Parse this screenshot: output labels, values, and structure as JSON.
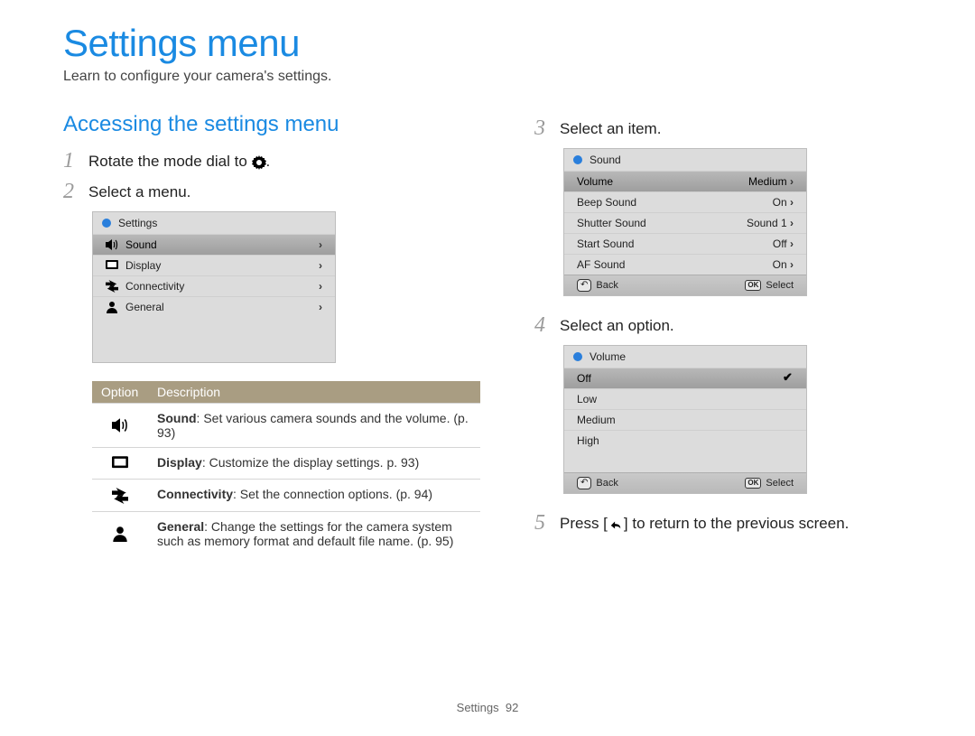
{
  "title": "Settings menu",
  "subtitle": "Learn to configure your camera's settings.",
  "section_heading": "Accessing the settings menu",
  "steps": {
    "s1": "Rotate the mode dial to",
    "s1_suffix": ".",
    "s2": "Select a menu.",
    "s3": "Select an item.",
    "s4": "Select an option.",
    "s5_pre": "Press [",
    "s5_post": "] to return to the previous screen."
  },
  "step_nums": {
    "n1": "1",
    "n2": "2",
    "n3": "3",
    "n4": "4",
    "n5": "5"
  },
  "lcd1": {
    "header": "Settings",
    "rows": {
      "r0": "Sound",
      "r1": "Display",
      "r2": "Connectivity",
      "r3": "General"
    }
  },
  "lcd2": {
    "header": "Sound",
    "rows": {
      "r0_l": "Volume",
      "r0_r": "Medium",
      "r1_l": "Beep Sound",
      "r1_r": "On",
      "r2_l": "Shutter Sound",
      "r2_r": "Sound 1",
      "r3_l": "Start Sound",
      "r3_r": "Off",
      "r4_l": "AF Sound",
      "r4_r": "On"
    },
    "footer": {
      "back": "Back",
      "select": "Select"
    }
  },
  "lcd3": {
    "header": "Volume",
    "rows": {
      "r0": "Off",
      "r1": "Low",
      "r2": "Medium",
      "r3": "High"
    },
    "footer": {
      "back": "Back",
      "select": "Select"
    }
  },
  "table": {
    "col_option": "Option",
    "col_desc": "Description",
    "rows": {
      "r0": {
        "bold": "Sound",
        "rest": ": Set various camera sounds and the volume. (p. 93)"
      },
      "r1": {
        "bold": "Display",
        "rest": ": Customize the display settings. p. 93)"
      },
      "r2": {
        "bold": "Connectivity",
        "rest": ": Set the connection options. (p. 94)"
      },
      "r3": {
        "bold": "General",
        "rest": ": Change the settings for the camera system such as memory format and default file name. (p. 95)"
      }
    }
  },
  "footer": {
    "section": "Settings",
    "page": "92"
  }
}
